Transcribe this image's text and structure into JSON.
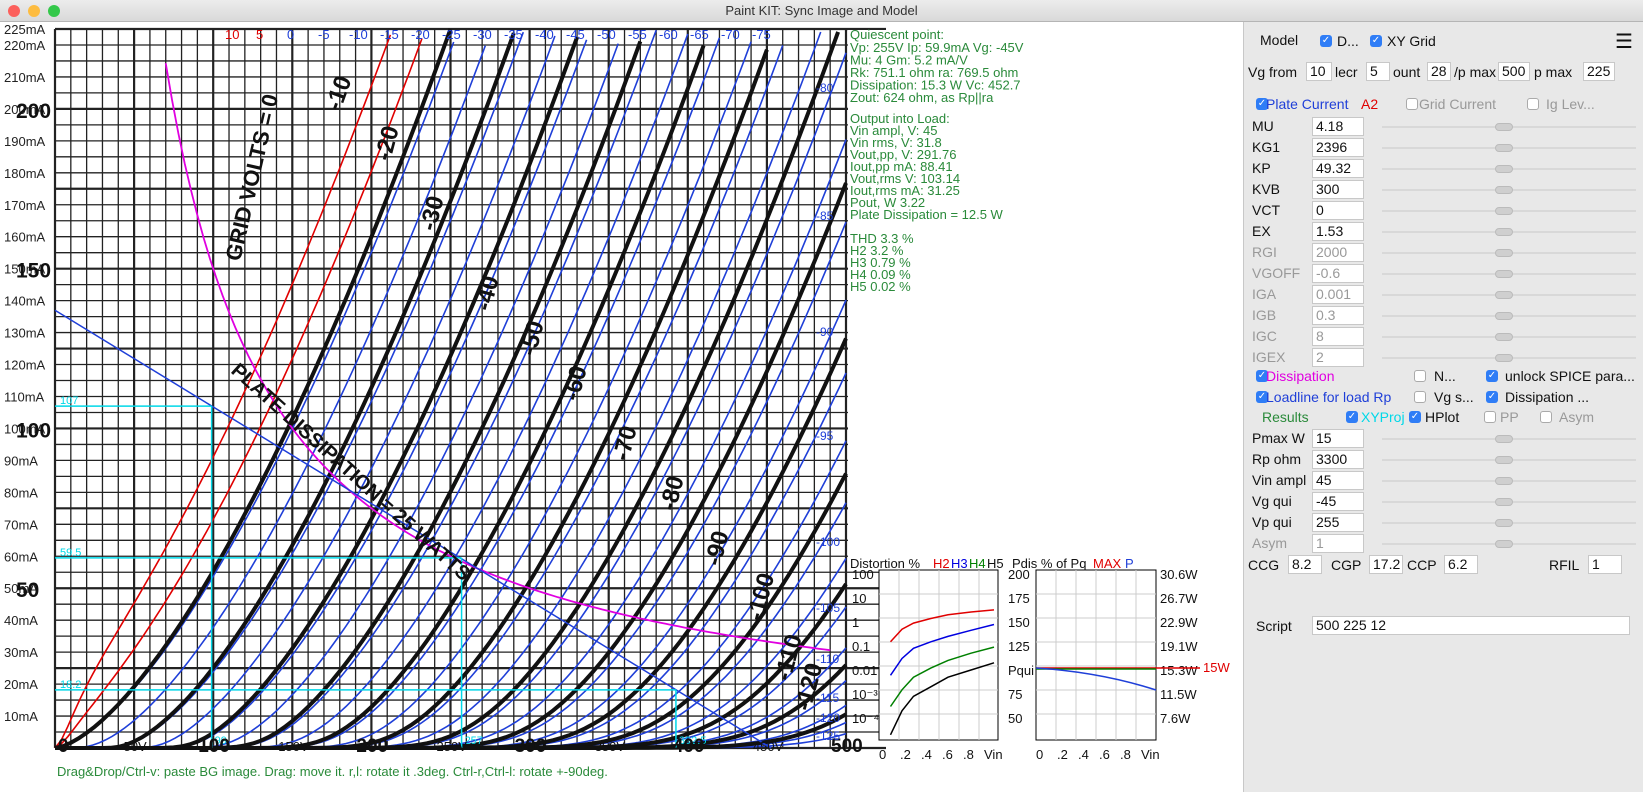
{
  "window": {
    "title": "Paint KIT: Sync Image and Model",
    "colors": {
      "close": "#fc605c",
      "minimize": "#fdbc40",
      "maximize": "#34c84a"
    }
  },
  "graph": {
    "y_axis_labels": [
      "225mA",
      "220mA",
      "210mA",
      "200mA",
      "190mA",
      "180mA",
      "170mA",
      "160mA",
      "150mA",
      "140mA",
      "130mA",
      "120mA",
      "110mA",
      "100mA",
      "90mA",
      "80mA",
      "70mA",
      "60mA",
      "50mA",
      "40mA",
      "30mA",
      "20mA",
      "10mA"
    ],
    "y_axis_values": [
      225,
      220,
      210,
      200,
      190,
      180,
      170,
      160,
      150,
      140,
      130,
      120,
      110,
      100,
      90,
      80,
      70,
      60,
      50,
      40,
      30,
      20,
      10
    ],
    "x_axis_labels": [
      "0",
      "50V",
      "100",
      "150V",
      "200",
      "250V",
      "300",
      "350V",
      "400",
      "450V",
      "500"
    ],
    "x_axis_values": [
      0,
      50,
      100,
      150,
      200,
      250,
      300,
      350,
      400,
      450,
      500
    ],
    "bg_y_labels": [
      "200",
      "150",
      "100",
      "50"
    ],
    "bg_y_values": [
      200,
      150,
      100,
      50
    ],
    "grid_top_labels": [
      "10",
      "5",
      "0",
      "-5",
      "-10",
      "-15",
      "-20",
      "-25",
      "-30",
      "-35",
      "-40",
      "-45",
      "-50",
      "-55",
      "-60",
      "-65",
      "-70",
      "-75"
    ],
    "grid_top_values": [
      10,
      5,
      0,
      -5,
      -10,
      -15,
      -20,
      -25,
      -30,
      -35,
      -40,
      -45,
      -50,
      -55,
      -60,
      -65,
      -70,
      -75
    ],
    "grid_right_labels": [
      "-80",
      "-85",
      "-90",
      "-95",
      "-100",
      "-105",
      "-110",
      "-115",
      "-120",
      "-125"
    ],
    "grid_right_values": [
      80,
      85,
      90,
      95,
      100,
      105,
      110,
      115,
      120,
      125
    ],
    "bg_curve_labels": [
      "-10",
      "-20",
      "-30",
      "-40",
      "-50",
      "-60",
      "-70",
      "-80",
      "-90",
      "-100",
      "-110",
      "-120"
    ],
    "bg_text_labels": [
      "GRID VOLTS = 0",
      "PLATE DISSIPATION = 25 WATTS"
    ],
    "proj_labels": [
      "107",
      "59.5",
      "18.2",
      "99",
      "257",
      "392.5"
    ],
    "quiescent": {
      "title": "Quiescent point:",
      "lines": [
        "Vp: 255V  Ip: 59.9mA  Vg: -45V",
        "Mu: 4 Gm: 5.2 mA/V",
        "Rk: 751.1 ohm ra: 769.5 ohm",
        "Dissipation: 15.3 W Vc: 452.7",
        "Zout: 624 ohm, as Rp||ra"
      ]
    },
    "output": {
      "title": "Output into Load:",
      "lines": [
        "Vin ampl, V: 45",
        "Vin rms,  V: 31.8",
        "Vout,pp,   V: 291.76",
        "Iout,pp   mA: 88.41",
        "Vout,rms   V: 103.14",
        "Iout,rms  mA: 31.25",
        "Pout, W      3.22",
        "Plate Dissipation = 12.5 W"
      ]
    },
    "thd": {
      "lines": [
        "THD 3.3 %",
        "  H2 3.2 %",
        "  H3 0.79 %",
        "  H4 0.09 %",
        "  H5 0.02 %"
      ]
    },
    "distortion": {
      "title_prefix": "Distortion %",
      "h2": "H2",
      "h3": "H3",
      "h4": "H4",
      "h5": "H5",
      "y_labels": [
        "100",
        "10",
        "1",
        "0.1",
        "0.01",
        "10⁻³",
        "10⁻⁴"
      ],
      "x_labels": [
        "0",
        ".2",
        ".4",
        ".6",
        ".8",
        "Vin"
      ],
      "series": [
        {
          "name": "H2",
          "color": "#e00000",
          "values": [
            0.15,
            0.5,
            0.9,
            1.4,
            2.0,
            2.6,
            3.2
          ]
        },
        {
          "name": "H3",
          "color": "#0000e0",
          "values": [
            0.006,
            0.03,
            0.08,
            0.15,
            0.25,
            0.45,
            0.79
          ]
        },
        {
          "name": "H4",
          "color": "#008000",
          "values": [
            0.0003,
            0.0015,
            0.005,
            0.012,
            0.025,
            0.05,
            0.09
          ]
        },
        {
          "name": "H5",
          "color": "#000000",
          "values": [
            2e-05,
            0.0002,
            0.0008,
            0.002,
            0.005,
            0.01,
            0.02
          ]
        }
      ],
      "x": [
        0.1,
        0.2,
        0.3,
        0.45,
        0.6,
        0.8,
        1.0
      ]
    },
    "pdis": {
      "title_prefix": "Pdis % of Pq",
      "max_label": "MAX",
      "p_label": "P",
      "y_left": [
        "200",
        "175",
        "150",
        "125",
        "Pqui",
        "75",
        "50"
      ],
      "y_right": [
        "30.6W",
        "26.7W",
        "22.9W",
        "19.1W",
        "15.3W",
        "11.5W",
        "7.6W"
      ],
      "x_labels": [
        "0",
        ".2",
        ".4",
        ".6",
        ".8",
        "Vin"
      ],
      "marker": "15W"
    },
    "status": "Drag&Drop/Ctrl-v: paste BG image. Drag: move it. r,l: rotate it .3deg. Ctrl-r,Ctrl-l: rotate +-90deg."
  },
  "panel": {
    "model_label": "Model",
    "d_label": "D...",
    "xy_grid_label": "XY Grid",
    "vg_from_label": "Vg from",
    "vg_from": "10",
    "decr_label": "lecr",
    "decr": "5",
    "count_label": "ount",
    "count": "28",
    "vpmax_label": "/p max",
    "vpmax": "500",
    "ipmax_label": "p max",
    "ipmax": "225",
    "plate_current_label": "Plate Current",
    "a2_label": "A2",
    "grid_current_label": "Grid Current",
    "ig_label": "Ig Lev...",
    "params": [
      {
        "name": "MU",
        "value": "4.18",
        "disabled": false
      },
      {
        "name": "KG1",
        "value": "2396",
        "disabled": false
      },
      {
        "name": "KP",
        "value": "49.32",
        "disabled": false
      },
      {
        "name": "KVB",
        "value": "300",
        "disabled": false
      },
      {
        "name": "VCT",
        "value": "0",
        "disabled": false
      },
      {
        "name": "EX",
        "value": "1.53",
        "disabled": false
      },
      {
        "name": "RGI",
        "value": "2000",
        "disabled": true
      },
      {
        "name": "VGOFF",
        "value": "-0.6",
        "disabled": true
      },
      {
        "name": "IGA",
        "value": "0.001",
        "disabled": true
      },
      {
        "name": "IGB",
        "value": "0.3",
        "disabled": true
      },
      {
        "name": "IGC",
        "value": "8",
        "disabled": true
      },
      {
        "name": "IGEX",
        "value": "2",
        "disabled": true
      }
    ],
    "dissipation_label": "Dissipation",
    "n_label": "N...",
    "unlock_label": "unlock SPICE para...",
    "loadline_label": "Loadline for load Rp",
    "vgs_label": "Vg s...",
    "dissipation2_label": "Dissipation ...",
    "results_label": "Results",
    "xyproj_label": "XYProj",
    "hplot_label": "HPlot",
    "pp_label": "PP",
    "asym_label": "Asym",
    "params2": [
      {
        "name": "Pmax W",
        "value": "15",
        "disabled": false
      },
      {
        "name": "Rp ohm",
        "value": "3300",
        "disabled": false
      },
      {
        "name": "Vin ampl",
        "value": "45",
        "disabled": false
      },
      {
        "name": "Vg qui",
        "value": "-45",
        "disabled": false
      },
      {
        "name": "Vp qui",
        "value": "255",
        "disabled": false
      },
      {
        "name": "Asym",
        "value": "1",
        "disabled": true
      }
    ],
    "ccg_label": "CCG",
    "ccg": "8.2",
    "cgp_label": "CGP",
    "cgp": "17.2",
    "ccp_label": "CCP",
    "ccp": "6.2",
    "rfil_label": "RFIL",
    "rfil": "1",
    "script_label": "Script",
    "script": "500 225 12",
    "colors": {
      "plate_current": "#1f3fd8",
      "a2": "#e00000",
      "dissipation": "#e000e0",
      "loadline": "#1f3fd8",
      "results": "#2a8a3a",
      "xyproj": "#00d8e8"
    }
  }
}
